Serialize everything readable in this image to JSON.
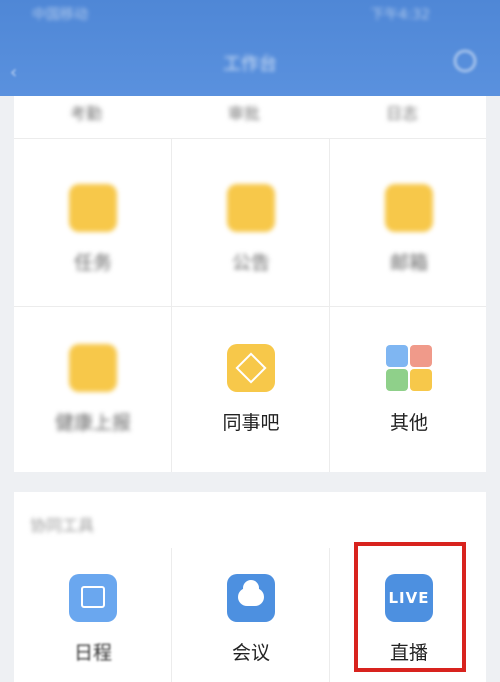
{
  "header": {
    "title": "工作台",
    "status_left": "中国移动",
    "status_right": "下午4:32"
  },
  "grid": {
    "top_row_labels": [
      "考勤",
      "审批",
      "日志"
    ],
    "row2": [
      {
        "label": "任务",
        "icon": "task-icon"
      },
      {
        "label": "公告",
        "icon": "notice-icon"
      },
      {
        "label": "邮箱",
        "icon": "mail-icon"
      }
    ],
    "row3": [
      {
        "label": "健康上报",
        "icon": "health-report-icon"
      },
      {
        "label": "同事吧",
        "icon": "colleague-icon"
      },
      {
        "label": "其他",
        "icon": "other-apps-icon"
      }
    ]
  },
  "tools": {
    "section_title": "协同工具",
    "items": [
      {
        "label": "日程",
        "icon": "calendar-icon"
      },
      {
        "label": "会议",
        "icon": "meeting-icon"
      },
      {
        "label": "直播",
        "icon": "live-icon",
        "icon_text": "LIVE"
      }
    ]
  },
  "colors": {
    "header_blue": "#5a91de",
    "icon_yellow": "#f7c84a",
    "icon_blue": "#6aa7ef",
    "highlight_red": "#d8231e"
  }
}
